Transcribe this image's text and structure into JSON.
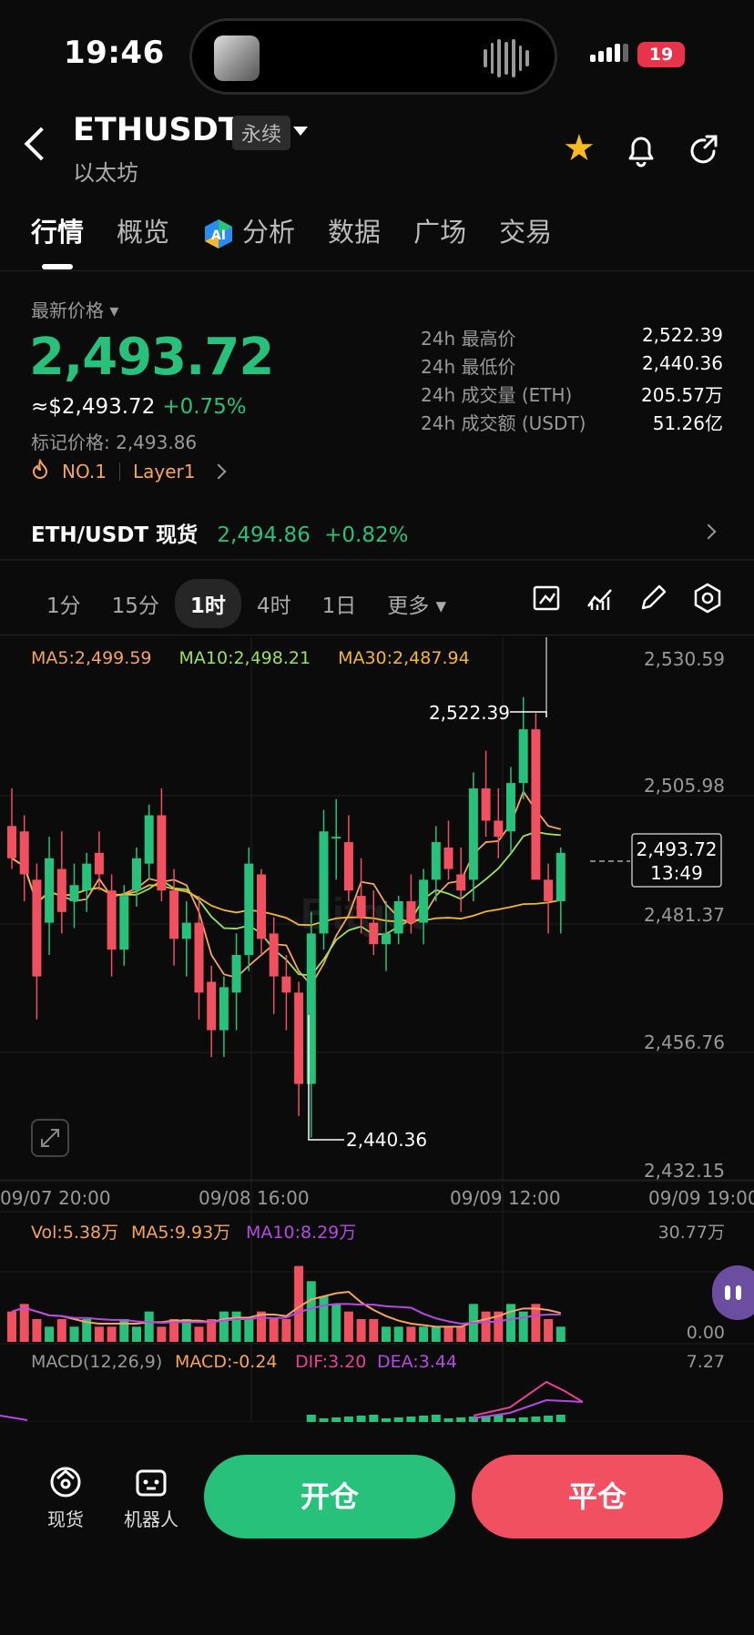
{
  "status_bar": {
    "time": "19:46",
    "battery": "19"
  },
  "header": {
    "symbol": "ETHUSDT",
    "tag": "永续",
    "subname": "以太坊"
  },
  "tabs": [
    "行情",
    "概览",
    "分析",
    "数据",
    "广场",
    "交易"
  ],
  "price": {
    "latest_label": "最新价格",
    "last": "2,493.72",
    "usd": "≈$2,493.72",
    "change": "+0.75%",
    "mark": "标记价格: 2,493.86",
    "tag_rank": "NO.1",
    "tag_sector": "Layer1"
  },
  "stats": [
    {
      "k": "24h 最高价",
      "v": "2,522.39"
    },
    {
      "k": "24h 最低价",
      "v": "2,440.36"
    },
    {
      "k": "24h 成交量 (ETH)",
      "v": "205.57万"
    },
    {
      "k": "24h 成交额 (USDT)",
      "v": "51.26亿"
    }
  ],
  "spot": {
    "name": "ETH/USDT 现货",
    "price": "2,494.86",
    "change": "+0.82%"
  },
  "intervals": [
    "1分",
    "15分",
    "1时",
    "4时",
    "1日",
    "更多"
  ],
  "chart": {
    "ma": {
      "ma5": "MA5:2,499.59",
      "ma10": "MA10:2,498.21",
      "ma30": "MA30:2,487.94"
    },
    "y_ticks": [
      "2,530.59",
      "2,505.98",
      "2,481.37",
      "2,456.76",
      "2,432.15"
    ],
    "x_ticks": [
      "09/07 20:00",
      "09/08 16:00",
      "09/09 12:00",
      "09/09 19:00"
    ],
    "high_label": "2,522.39",
    "low_label": "2,440.36",
    "current_price": "2,493.72",
    "countdown": "13:49",
    "watermark": "Bitget",
    "vol_legend": {
      "vol": "Vol:5.38万",
      "ma5": "MA5:9.93万",
      "ma10": "MA10:8.29万"
    },
    "vol_max": "30.77万",
    "vol_min": "0.00",
    "macd_legend": {
      "name": "MACD(12,26,9)",
      "macd": "MACD:-0.24",
      "dif": "DIF:3.20",
      "dea": "DEA:3.44"
    },
    "macd_max": "7.27"
  },
  "colors": {
    "up": "#27c17c",
    "down": "#f0505f",
    "ma5": "#f4a460",
    "ma10": "#9be15d",
    "ma30": "#f5b731",
    "vol_ma10": "#b44be1"
  },
  "chart_data": {
    "type": "candlestick",
    "y_range": [
      2432.15,
      2530.59
    ],
    "candles": [
      [
        2498,
        2505,
        2490,
        2492
      ],
      [
        2497,
        2500,
        2484,
        2489
      ],
      [
        2488,
        2491,
        2462,
        2470
      ],
      [
        2480,
        2496,
        2474,
        2492
      ],
      [
        2490,
        2497,
        2478,
        2482
      ],
      [
        2484,
        2491,
        2479,
        2487
      ],
      [
        2486,
        2493,
        2482,
        2491
      ],
      [
        2493,
        2497,
        2486,
        2489
      ],
      [
        2486,
        2489,
        2470,
        2475
      ],
      [
        2475,
        2487,
        2472,
        2485
      ],
      [
        2486,
        2494,
        2483,
        2492
      ],
      [
        2491,
        2502,
        2488,
        2500
      ],
      [
        2500,
        2505,
        2484,
        2486
      ],
      [
        2486,
        2490,
        2472,
        2477
      ],
      [
        2477,
        2484,
        2470,
        2480
      ],
      [
        2480,
        2485,
        2462,
        2467
      ],
      [
        2469,
        2472,
        2455,
        2460
      ],
      [
        2460,
        2470,
        2455,
        2468
      ],
      [
        2467,
        2478,
        2460,
        2474
      ],
      [
        2474,
        2494,
        2471,
        2491
      ],
      [
        2489,
        2490,
        2474,
        2477
      ],
      [
        2478,
        2481,
        2463,
        2470
      ],
      [
        2470,
        2474,
        2460,
        2467
      ],
      [
        2467,
        2469,
        2444,
        2450
      ],
      [
        2450,
        2482,
        2440,
        2478
      ],
      [
        2478,
        2501,
        2475,
        2497
      ],
      [
        2496,
        2503,
        2488,
        2496
      ],
      [
        2495,
        2500,
        2484,
        2486
      ],
      [
        2485,
        2492,
        2478,
        2481
      ],
      [
        2480,
        2486,
        2474,
        2476
      ],
      [
        2476,
        2484,
        2471,
        2478
      ],
      [
        2478,
        2485,
        2476,
        2484
      ],
      [
        2484,
        2489,
        2478,
        2480
      ],
      [
        2480,
        2490,
        2476,
        2488
      ],
      [
        2488,
        2498,
        2484,
        2495
      ],
      [
        2494,
        2499,
        2488,
        2490
      ],
      [
        2489,
        2494,
        2482,
        2486
      ],
      [
        2488,
        2508,
        2484,
        2505
      ],
      [
        2505,
        2512,
        2496,
        2499
      ],
      [
        2499,
        2505,
        2492,
        2496
      ],
      [
        2497,
        2509,
        2493,
        2506
      ],
      [
        2506,
        2522,
        2503,
        2516
      ],
      [
        2516,
        2519,
        2488,
        2488
      ],
      [
        2488,
        2491,
        2478,
        2484
      ],
      [
        2484,
        2494,
        2478,
        2493
      ]
    ],
    "volume_max": "30.77万"
  }
}
